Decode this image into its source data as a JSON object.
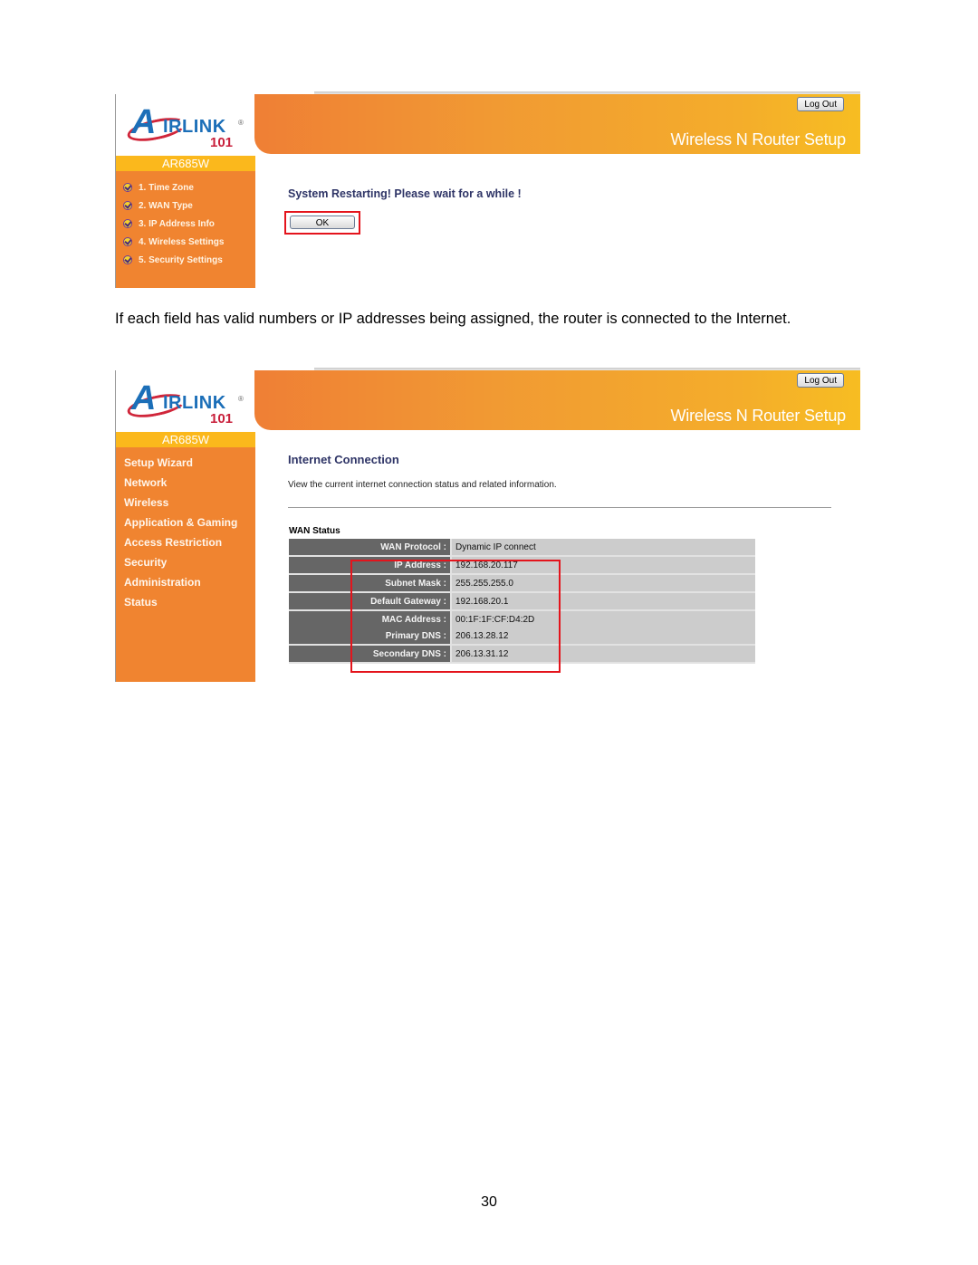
{
  "screenshot1": {
    "logo": {
      "big_letter": "A",
      "text": "IRLINK",
      "number": "101",
      "registered": "®"
    },
    "model": "AR685W",
    "logout_label": "Log Out",
    "banner_title": "Wireless N Router Setup",
    "wizard_steps": [
      {
        "label": "1. Time Zone",
        "icon": "check-icon"
      },
      {
        "label": "2. WAN Type",
        "icon": "check-icon"
      },
      {
        "label": "3. IP Address Info",
        "icon": "check-icon"
      },
      {
        "label": "4. Wireless Settings",
        "icon": "check-icon"
      },
      {
        "label": "5. Security Settings",
        "icon": "check-icon"
      }
    ],
    "message": "System Restarting! Please wait for a while !",
    "ok_label": "OK",
    "highlight_color": "#e4141c"
  },
  "paragraph": "If each field has valid numbers or IP addresses being assigned, the router is connected to the Internet.",
  "screenshot2": {
    "logo": {
      "big_letter": "A",
      "text": "IRLINK",
      "number": "101",
      "registered": "®"
    },
    "model": "AR685W",
    "logout_label": "Log Out",
    "banner_title": "Wireless N Router Setup",
    "menu": [
      "Setup Wizard",
      "Network",
      "Wireless",
      "Application & Gaming",
      "Access Restriction",
      "Security",
      "Administration",
      "Status"
    ],
    "section_title": "Internet Connection",
    "section_description": "View the current internet connection status and related information.",
    "wan_status": {
      "title": "WAN Status",
      "rows": [
        {
          "label": "WAN Protocol :",
          "value": "Dynamic IP connect"
        },
        {
          "label": "IP Address :",
          "value": "192.168.20.117"
        },
        {
          "label": "Subnet Mask :",
          "value": "255.255.255.0"
        },
        {
          "label": "Default Gateway :",
          "value": "192.168.20.1"
        },
        {
          "label": "MAC Address :",
          "value": "00:1F:1F:CF:D4:2D"
        },
        {
          "label": "Primary DNS :",
          "value": "206.13.28.12"
        },
        {
          "label": "Secondary DNS :",
          "value": "206.13.31.12"
        }
      ]
    },
    "highlight_color": "#e4141c"
  },
  "page_number": "30",
  "colors": {
    "sidebar_orange": "#f08430",
    "model_bar": "#fbb81c",
    "title_navy": "#2e3466",
    "label_cell": "#666666",
    "value_cell": "#cccccc"
  }
}
